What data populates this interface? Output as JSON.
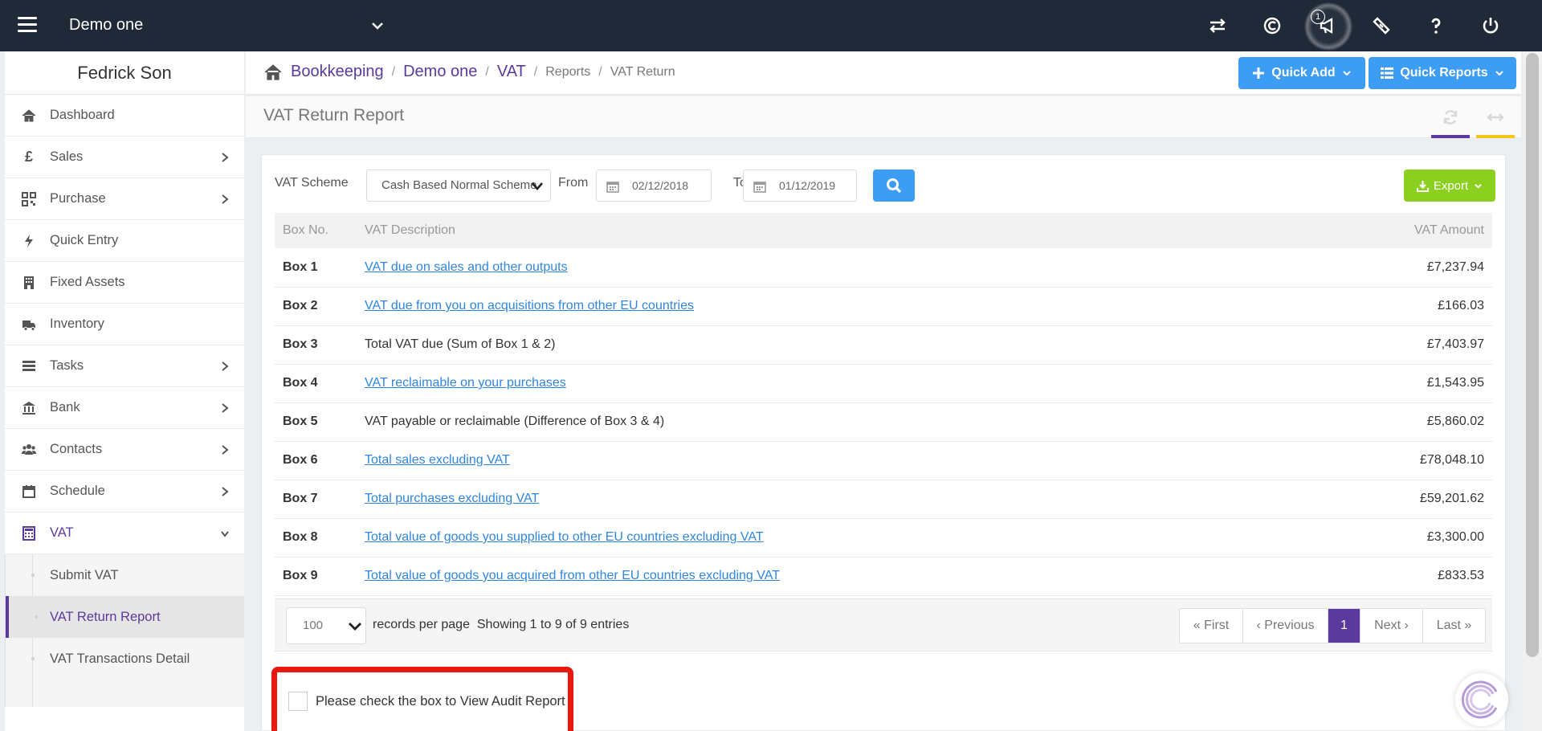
{
  "topbar": {
    "company": "Demo one",
    "notification_count": "1",
    "icons": [
      "transfer-icon",
      "copyright-icon",
      "megaphone-icon",
      "ticket-icon",
      "help-icon",
      "power-icon"
    ]
  },
  "sidebar": {
    "user_name": "Fedrick Son",
    "items": [
      {
        "label": "Dashboard",
        "icon": "home-icon",
        "has_children": false
      },
      {
        "label": "Sales",
        "icon": "pound-icon",
        "has_children": true
      },
      {
        "label": "Purchase",
        "icon": "qrcode-icon",
        "has_children": true
      },
      {
        "label": "Quick Entry",
        "icon": "bolt-icon",
        "has_children": false
      },
      {
        "label": "Fixed Assets",
        "icon": "building-icon",
        "has_children": false
      },
      {
        "label": "Inventory",
        "icon": "truck-icon",
        "has_children": false
      },
      {
        "label": "Tasks",
        "icon": "tasks-icon",
        "has_children": true
      },
      {
        "label": "Bank",
        "icon": "bank-icon",
        "has_children": true
      },
      {
        "label": "Contacts",
        "icon": "users-icon",
        "has_children": true
      },
      {
        "label": "Schedule",
        "icon": "calendar-icon",
        "has_children": true
      },
      {
        "label": "VAT",
        "icon": "calculator-icon",
        "has_children": true,
        "expanded": true
      }
    ],
    "vat_sub_items": [
      {
        "label": "Submit VAT"
      },
      {
        "label": "VAT Return Report",
        "current": true
      },
      {
        "label": "VAT Transactions Detail"
      }
    ]
  },
  "breadcrumb": {
    "links": [
      "Bookkeeping",
      "Demo one",
      "VAT"
    ],
    "plain": [
      "Reports",
      "VAT Return"
    ]
  },
  "header_buttons": {
    "quick_add": "Quick Add",
    "quick_reports": "Quick Reports"
  },
  "page": {
    "title": "VAT Return Report"
  },
  "filters": {
    "scheme_label": "VAT Scheme",
    "scheme_value": "Cash Based Normal Scheme",
    "from_label": "From",
    "from_value": "02/12/2018",
    "to_label": "To",
    "to_value": "01/12/2019",
    "export_label": "Export"
  },
  "table": {
    "headers": [
      "Box No.",
      "VAT Description",
      "VAT Amount"
    ],
    "rows": [
      {
        "box": "Box 1",
        "description": "VAT due on sales and other outputs",
        "link": true,
        "amount": "£7,237.94",
        "negative": false
      },
      {
        "box": "Box 2",
        "description": "VAT due from you on acquisitions from other EU countries",
        "link": true,
        "amount": "£166.03",
        "negative": false
      },
      {
        "box": "Box 3",
        "description": "Total VAT due (Sum of Box 1 & 2)",
        "link": false,
        "amount": "£7,403.97",
        "negative": false
      },
      {
        "box": "Box 4",
        "description": "VAT reclaimable on your purchases",
        "link": true,
        "amount": "£1,543.95",
        "negative": false
      },
      {
        "box": "Box 5",
        "description": "VAT payable or reclaimable (Difference of Box 3 & 4)",
        "link": false,
        "amount": "£5,860.02",
        "negative": true
      },
      {
        "box": "Box 6",
        "description": "Total sales excluding VAT",
        "link": true,
        "amount": "£78,048.10",
        "negative": false
      },
      {
        "box": "Box 7",
        "description": "Total purchases excluding VAT",
        "link": true,
        "amount": "£59,201.62",
        "negative": false
      },
      {
        "box": "Box 8",
        "description": "Total value of goods you supplied to other EU countries excluding VAT",
        "link": true,
        "amount": "£3,300.00",
        "negative": false
      },
      {
        "box": "Box 9",
        "description": "Total value of goods you acquired from other EU countries excluding VAT",
        "link": true,
        "amount": "£833.53",
        "negative": false
      }
    ]
  },
  "pagination": {
    "per_page": "100",
    "per_page_label": "records per page",
    "showing": "Showing 1 to 9 of 9 entries",
    "first": "First",
    "previous": "Previous",
    "current": "1",
    "next": "Next",
    "last": "Last"
  },
  "audit": {
    "label": "Please check the box to View Audit Report",
    "checked": false
  },
  "colors": {
    "navbar": "#1f2937",
    "accent_purple": "#5b3a9e",
    "button_blue": "#3d9cf3",
    "export_green": "#8bd01e",
    "link_blue": "#2e86de",
    "negative_red": "#e03a2f",
    "highlight_red": "#e8190f"
  }
}
